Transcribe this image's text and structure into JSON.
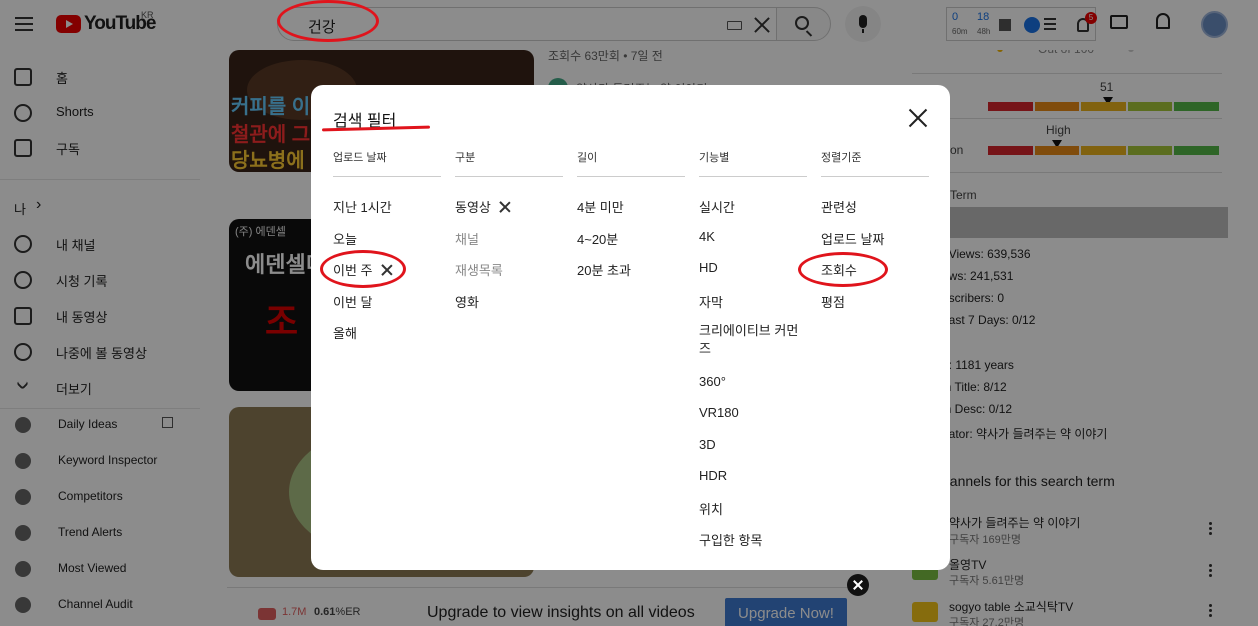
{
  "header": {
    "logo_text": "YouTube",
    "region": "KR",
    "search_value": "건강",
    "ext_num1": "0",
    "ext_sub1": "60m",
    "ext_num2": "18",
    "ext_sub2": "48h",
    "notif_count": "5"
  },
  "sidebar": {
    "home": "홈",
    "shorts": "Shorts",
    "subs": "구독",
    "me": "나",
    "me_chevron": "›",
    "my_channel": "내 채널",
    "history": "시청 기록",
    "my_videos": "내 동영상",
    "watch_later": "나중에 볼 동영상",
    "more": "더보기",
    "ext_items": [
      "Daily Ideas",
      "Keyword Inspector",
      "Competitors",
      "Trend Alerts",
      "Most Viewed",
      "Channel Audit"
    ]
  },
  "content": {
    "meta1": "조회수 63만회 • 7일 전",
    "channel1": "약사가 들려주는 약 이야기",
    "thumb1_line1": "커피를 이",
    "thumb1_line2": "철관에 그",
    "thumb1_line3": "당뇨병에",
    "thumb2_tag": "(주) 에덴셀",
    "thumb2_line1": "에덴셀미",
    "thumb2_line2": "조"
  },
  "right_panel": {
    "out_of": "Out of 100",
    "score": "51",
    "high": "High",
    "competition_label": "tition",
    "term_label": "Term",
    "stats": [
      "t Views: 639,536",
      "ews: 241,531",
      "bscribers: 0",
      "Last 7 Days: 0/12",
      "2",
      "e: 1181 years",
      "in Title: 8/12",
      "in Desc: 0/12",
      "eator: 약사가 들려주는 약 이야기"
    ],
    "channels_head": "hannels for this search term",
    "channels": [
      {
        "name": "약사가 들려주는 약 이야기",
        "subs": "구독자 169만명"
      },
      {
        "name": "올영TV",
        "subs": "구독자 5.61만명"
      },
      {
        "name": "sogyo table 소교식탁TV",
        "subs": "구독자 27.2만명"
      }
    ]
  },
  "banner": {
    "views": "1.7M",
    "er_value": "0.61",
    "er_unit": "%ER",
    "text": "Upgrade to view insights on all videos",
    "button": "Upgrade Now!"
  },
  "dialog": {
    "title": "검색 필터",
    "columns": [
      {
        "header": "업로드 날짜",
        "items": [
          "지난 1시간",
          "오늘",
          "이번 주",
          "이번 달",
          "올해"
        ]
      },
      {
        "header": "구분",
        "items": [
          "동영상",
          "채널",
          "재생목록",
          "영화"
        ]
      },
      {
        "header": "길이",
        "items": [
          "4분 미만",
          "4~20분",
          "20분 초과"
        ]
      },
      {
        "header": "기능별",
        "items": [
          "실시간",
          "4K",
          "HD",
          "자막",
          "크리에이티브 커먼즈",
          "360°",
          "VR180",
          "3D",
          "HDR",
          "위치",
          "구입한 항목"
        ]
      },
      {
        "header": "정렬기준",
        "items": [
          "관련성",
          "업로드 날짜",
          "조회수",
          "평점"
        ]
      }
    ]
  },
  "colors": {
    "annotation": "#e0141c",
    "brand_red": "#ff0000",
    "upgrade_blue": "#3f7ad1"
  }
}
